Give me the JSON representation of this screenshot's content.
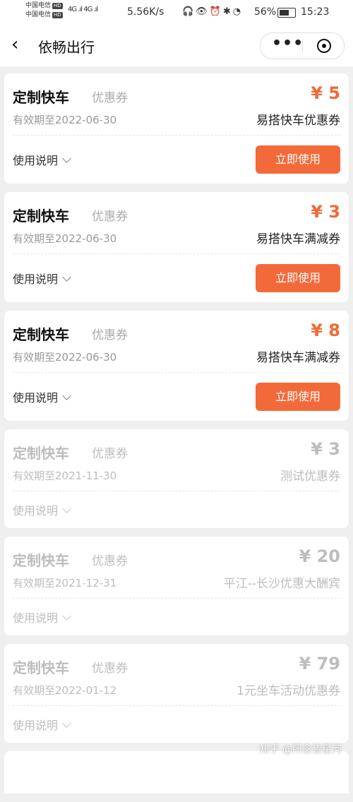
{
  "status_bar": {
    "carrier1": "中国电信",
    "carrier2": "中国电信",
    "hd": "HD",
    "signal": "4G .ıl 4G .ıl",
    "speed": "5.56K/s",
    "icons": "🎧👁⏰✱◔",
    "battery": "56%",
    "time": "15:23"
  },
  "header": {
    "back_icon": "‹",
    "title": "依畅出行",
    "more_icon": "•••"
  },
  "colors": {
    "accent": "#f36a3a",
    "amount": "#f06a34",
    "inactive": "#bdbdbd"
  },
  "coupons": [
    {
      "title": "定制快车",
      "tag": "优惠券",
      "expiry": "有效期至2022-06-30",
      "amount": "¥ 5",
      "name": "易搭快车优惠券",
      "howto": "使用说明",
      "button": "立即使用"
    },
    {
      "title": "定制快车",
      "tag": "优惠券",
      "expiry": "有效期至2022-06-30",
      "amount": "¥ 3",
      "name": "易搭快车满减券",
      "howto": "使用说明",
      "button": "立即使用"
    },
    {
      "title": "定制快车",
      "tag": "优惠券",
      "expiry": "有效期至2022-06-30",
      "amount": "¥ 8",
      "name": "易搭快车满减券",
      "howto": "使用说明",
      "button": "立即使用"
    },
    {
      "title": "定制快车",
      "tag": "优惠券",
      "expiry": "有效期至2021-11-30",
      "amount": "¥ 3",
      "name": "测试优惠券",
      "howto": "使用说明"
    },
    {
      "title": "定制快车",
      "tag": "优惠券",
      "expiry": "有效期至2021-12-31",
      "amount": "¥ 20",
      "name": "平江--长沙优惠大酬宾",
      "howto": "使用说明"
    },
    {
      "title": "定制快车",
      "tag": "优惠券",
      "expiry": "有效期至2022-01-12",
      "amount": "¥ 79",
      "name": "1元坐车活动优惠券",
      "howto": "使用说明"
    }
  ],
  "watermark": "知乎 @所念皆星河"
}
